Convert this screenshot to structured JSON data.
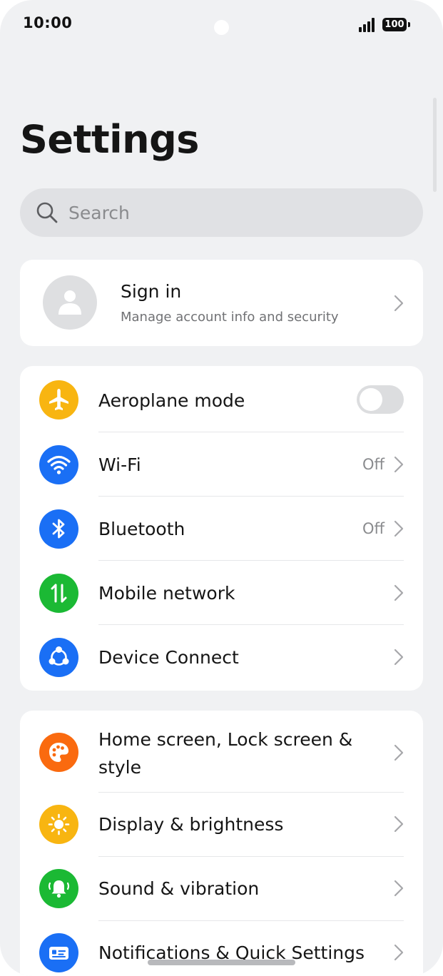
{
  "status_bar": {
    "time": "10:00",
    "battery": "100"
  },
  "page": {
    "title": "Settings"
  },
  "search": {
    "placeholder": "Search"
  },
  "account": {
    "title": "Sign in",
    "subtitle": "Manage account info and security"
  },
  "group1": [
    {
      "label": "Aeroplane mode",
      "icon": "airplane-icon",
      "color": "#f8b511",
      "control": "toggle",
      "toggle_on": false
    },
    {
      "label": "Wi-Fi",
      "icon": "wifi-icon",
      "color": "#1a6ff5",
      "value": "Off"
    },
    {
      "label": "Bluetooth",
      "icon": "bluetooth-icon",
      "color": "#1a6ff5",
      "value": "Off"
    },
    {
      "label": "Mobile network",
      "icon": "mobile-network-icon",
      "color": "#1bb934"
    },
    {
      "label": "Device Connect",
      "icon": "device-connect-icon",
      "color": "#1a6ff5"
    }
  ],
  "group2": [
    {
      "label": "Home screen, Lock screen &",
      "label_line2": "style",
      "icon": "palette-icon",
      "color": "#fa6a0f"
    },
    {
      "label": "Display & brightness",
      "icon": "sun-icon",
      "color": "#f8b511"
    },
    {
      "label": "Sound & vibration",
      "icon": "bell-icon",
      "color": "#1bb934"
    },
    {
      "label": "Notifications & Quick Settings",
      "icon": "notifications-icon",
      "color": "#1a6ff5"
    }
  ]
}
